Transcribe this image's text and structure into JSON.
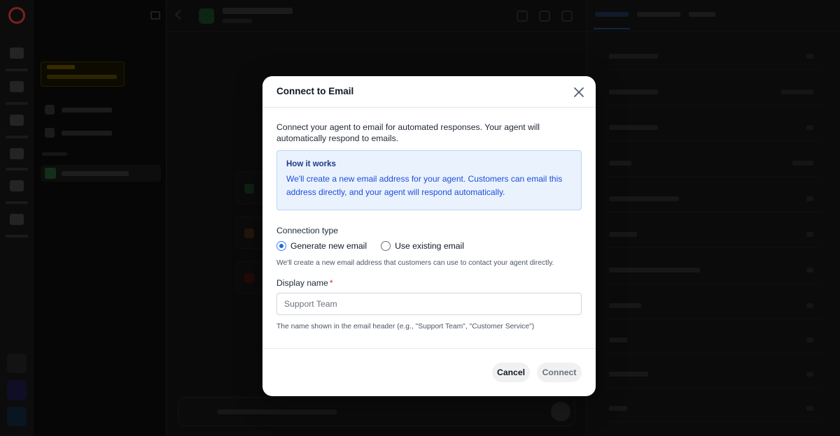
{
  "modal": {
    "title": "Connect to Email",
    "intro": "Connect your agent to email for automated responses. Your agent will automatically respond to emails.",
    "info": {
      "title": "How it works",
      "text": "We'll create a new email address for your agent. Customers can email this address directly, and your agent will respond automatically."
    },
    "connection_type": {
      "label": "Connection type",
      "options": [
        {
          "label": "Generate new email",
          "selected": true
        },
        {
          "label": "Use existing email",
          "selected": false
        }
      ],
      "helper": "We'll create a new email address that customers can use to contact your agent directly."
    },
    "display_name": {
      "label": "Display name",
      "required_mark": "*",
      "value": "",
      "placeholder": "Support Team",
      "helper": "The name shown in the email header (e.g., \"Support Team\", \"Customer Service\")"
    },
    "buttons": {
      "cancel": "Cancel",
      "connect": "Connect"
    }
  },
  "colors": {
    "accent": "#2563eb",
    "info_bg": "#eaf2fe",
    "info_border": "#bcd3f7",
    "required": "#dc2626"
  }
}
